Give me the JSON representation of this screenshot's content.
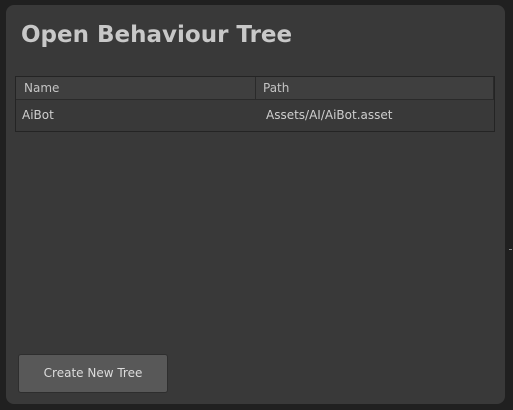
{
  "window": {
    "title": "Open Behaviour Tree"
  },
  "table": {
    "columns": [
      {
        "label": "Name"
      },
      {
        "label": "Path"
      }
    ],
    "rows": [
      {
        "name": "AiBot",
        "path": "Assets/AI/AiBot.asset"
      }
    ]
  },
  "actions": {
    "create_label": "Create New Tree"
  }
}
